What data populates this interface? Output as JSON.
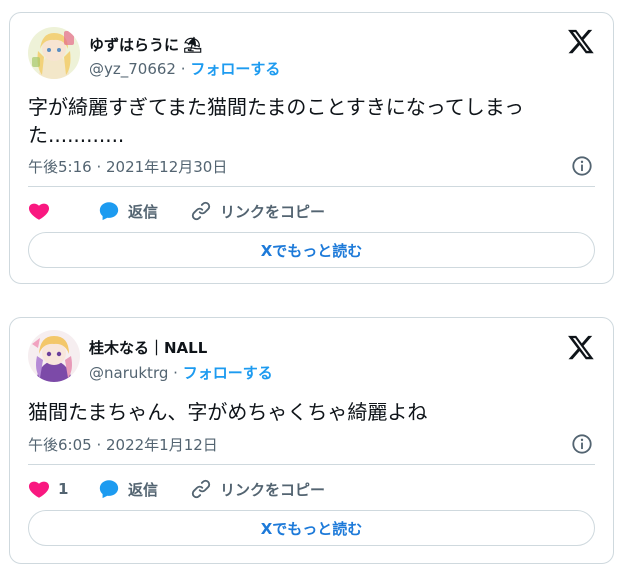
{
  "tweets": [
    {
      "display_name": "ゆずはらうに",
      "name_emoji": "⛱",
      "handle": "@yz_70662",
      "separator": "·",
      "follow_label": "フォローする",
      "text": "字が綺麗すぎてまた猫間たまのことすきになってしまった............",
      "timestamp": "午後5:16 · 2021年12月30日",
      "like_count": "",
      "reply_label": "返信",
      "copy_link_label": "リンクをコピー",
      "more_label": "Xでもっと読む"
    },
    {
      "display_name": "桂木なる｜NALL",
      "handle": "@naruktrg",
      "separator": "·",
      "follow_label": "フォローする",
      "text": "猫間たまちゃん、字がめちゃくちゃ綺麗よね",
      "timestamp": "午後6:05 · 2022年1月12日",
      "like_count": "1",
      "reply_label": "返信",
      "copy_link_label": "リンクをコピー",
      "more_label": "Xでもっと読む"
    }
  ],
  "colors": {
    "accent": "#1d9bf0",
    "like": "#f91880",
    "muted": "#536471",
    "border": "#cfd9de"
  },
  "icons": [
    "x-logo-icon",
    "info-icon",
    "heart-icon",
    "reply-bubble-icon",
    "link-icon"
  ]
}
